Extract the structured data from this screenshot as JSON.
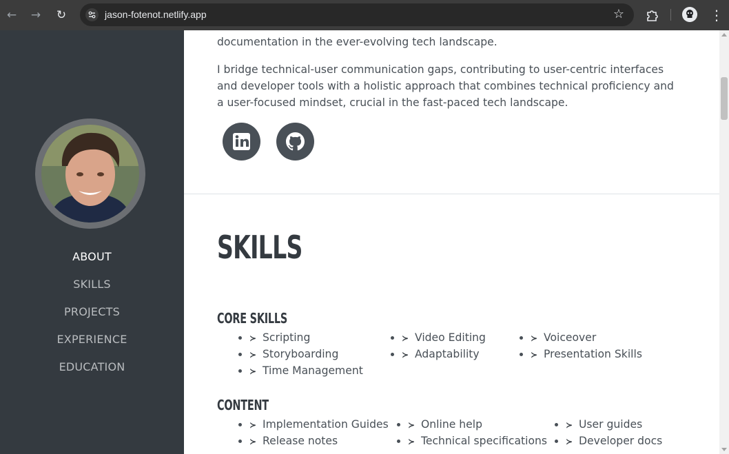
{
  "browser": {
    "url": "jason-fotenot.netlify.app",
    "back_icon": "←",
    "forward_icon": "→",
    "reload_icon": "↻",
    "star_icon": "☆",
    "menu_icon": "⋮"
  },
  "sidebar": {
    "nav": [
      {
        "label": "ABOUT",
        "active": true
      },
      {
        "label": "SKILLS",
        "active": false
      },
      {
        "label": "PROJECTS",
        "active": false
      },
      {
        "label": "EXPERIENCE",
        "active": false
      },
      {
        "label": "EDUCATION",
        "active": false
      }
    ]
  },
  "about": {
    "partial_line": "documentation in the ever-evolving tech landscape.",
    "paragraph": "I bridge technical-user communication gaps, contributing to user-centric interfaces and developer tools with a holistic approach that combines technical proficiency and a user-focused mindset, crucial in the fast-paced tech landscape.",
    "social": [
      {
        "name": "linkedin",
        "icon": "linkedin-icon"
      },
      {
        "name": "github",
        "icon": "github-icon"
      }
    ]
  },
  "skills": {
    "title": "SKILLS",
    "bullet": "≻",
    "core": {
      "title": "CORE SKILLS",
      "items": [
        "Scripting",
        "Video Editing",
        "Voiceover",
        "Storyboarding",
        "Adaptability",
        "Presentation Skills",
        "Time Management"
      ]
    },
    "content": {
      "title": "CONTENT",
      "items": [
        "Implementation Guides",
        "Online help",
        "User guides",
        "Release notes",
        "Technical specifications",
        "Developer docs"
      ]
    }
  },
  "colors": {
    "sidebar_bg": "#343a40",
    "nav_active": "#ffffff",
    "nav_inactive": "#b9bcbf",
    "text": "#495057",
    "heading": "#343a40",
    "social_bg": "#495057"
  }
}
